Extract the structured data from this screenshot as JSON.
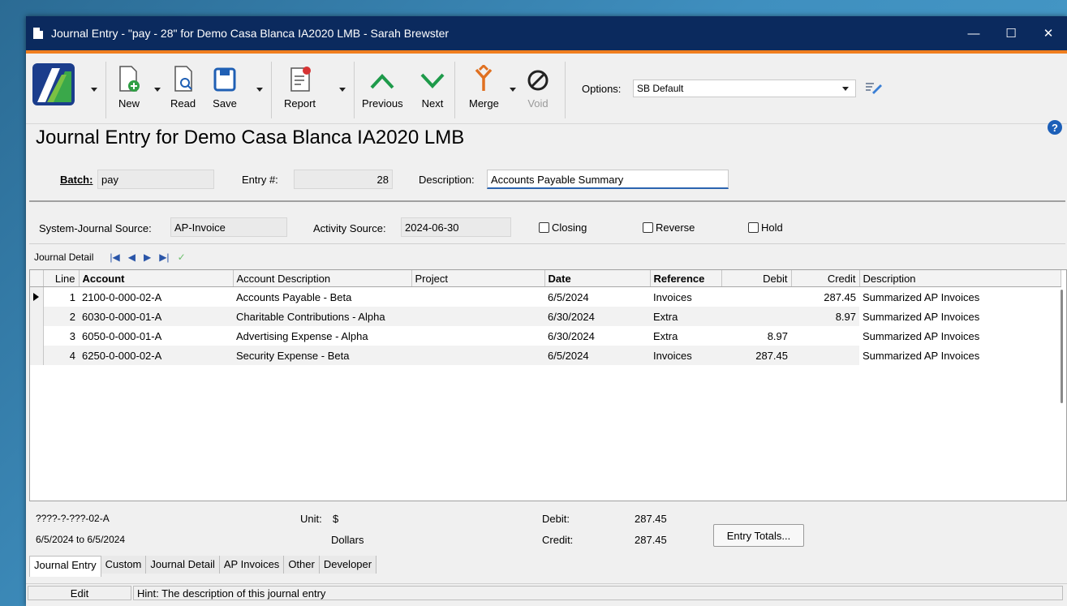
{
  "window": {
    "title": "Journal Entry - \"pay - 28\" for Demo Casa Blanca IA2020 LMB - Sarah Brewster",
    "minimize": "—",
    "maximize": "☐",
    "close": "✕"
  },
  "toolbar": {
    "new": "New",
    "read": "Read",
    "save": "Save",
    "report": "Report",
    "previous": "Previous",
    "next": "Next",
    "merge": "Merge",
    "void": "Void",
    "options_label": "Options:",
    "options_value": "SB Default"
  },
  "heading": "Journal Entry for Demo Casa Blanca IA2020 LMB",
  "fields": {
    "batch_label": "Batch:",
    "batch_value": "pay",
    "entry_label": "Entry #:",
    "entry_value": "28",
    "description_label": "Description:",
    "description_value": "Accounts Payable Summary"
  },
  "source": {
    "system_label": "System-Journal Source:",
    "system_value": "AP-Invoice",
    "activity_label": "Activity Source:",
    "activity_value": "2024-06-30",
    "closing": "Closing",
    "reverse": "Reverse",
    "hold": "Hold"
  },
  "detail_label": "Journal Detail",
  "grid": {
    "headers": [
      "Line",
      "Account",
      "Account Description",
      "Project",
      "Date",
      "Reference",
      "Debit",
      "Credit",
      "Description"
    ],
    "rows": [
      {
        "line": "1",
        "account": "2100-0-000-02-A",
        "acct_desc": "Accounts Payable - Beta",
        "project": "",
        "date": "6/5/2024",
        "reference": "Invoices",
        "debit": "",
        "credit": "287.45",
        "desc": "Summarized AP Invoices"
      },
      {
        "line": "2",
        "account": "6030-0-000-01-A",
        "acct_desc": "Charitable Contributions - Alpha",
        "project": "",
        "date": "6/30/2024",
        "reference": "Extra",
        "debit": "",
        "credit": "8.97",
        "desc": "Summarized AP Invoices"
      },
      {
        "line": "3",
        "account": "6050-0-000-01-A",
        "acct_desc": "Advertising Expense - Alpha",
        "project": "",
        "date": "6/30/2024",
        "reference": "Extra",
        "debit": "8.97",
        "credit": "",
        "desc": "Summarized AP Invoices"
      },
      {
        "line": "4",
        "account": "6250-0-000-02-A",
        "acct_desc": "Security Expense - Beta",
        "project": "",
        "date": "6/5/2024",
        "reference": "Invoices",
        "debit": "287.45",
        "credit": "",
        "desc": "Summarized AP Invoices"
      }
    ]
  },
  "footer": {
    "account_mask": "????-?-???-02-A",
    "date_range": "6/5/2024  to  6/5/2024",
    "unit_label": "Unit:",
    "unit_value": "$",
    "unit_name": "Dollars",
    "debit_label": "Debit:",
    "debit_value": "287.45",
    "credit_label": "Credit:",
    "credit_value": "287.45",
    "entry_totals": "Entry Totals..."
  },
  "tabs": [
    "Journal Entry",
    "Custom",
    "Journal Detail",
    "AP Invoices",
    "Other",
    "Developer"
  ],
  "status": {
    "mode": "Edit",
    "hint": "Hint:  The description of this journal entry"
  },
  "colors": {
    "titlebar": "#0b2a5e",
    "accent_strip": "#f07e1f",
    "nav_green": "#1e9a4a"
  }
}
